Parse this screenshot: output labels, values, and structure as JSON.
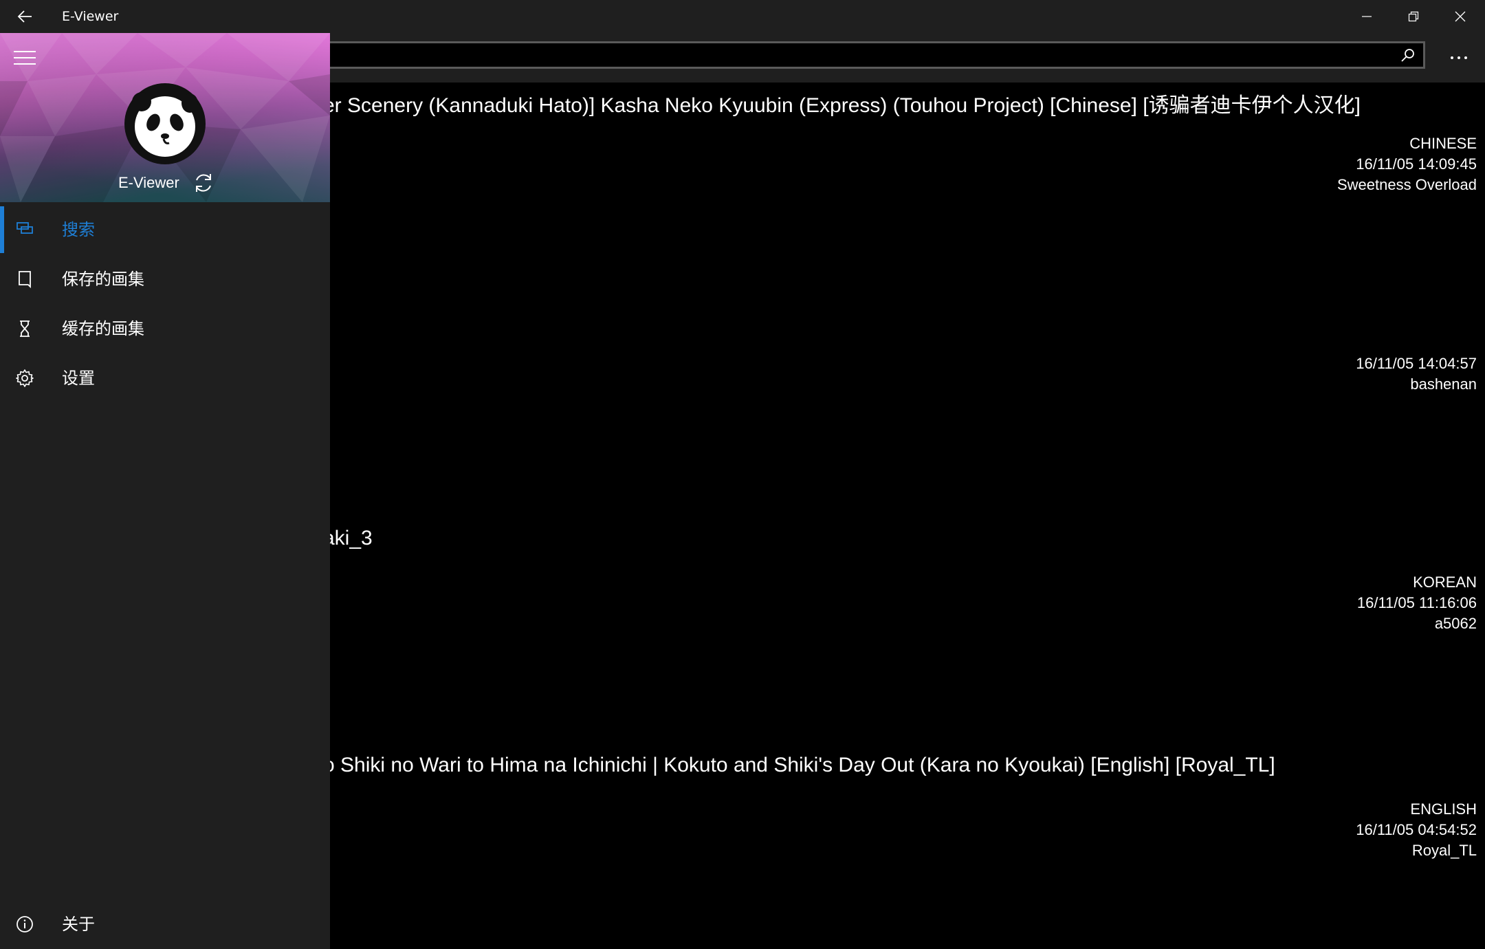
{
  "window": {
    "title": "E-Viewer",
    "controls": {
      "minimize": "minimize-icon",
      "maximize": "restore-icon",
      "close": "close-icon"
    }
  },
  "search": {
    "value": "",
    "placeholder": ""
  },
  "results": [
    {
      "title": "er Scenery (Kannaduki Hato)] Kasha Neko Kyuubin (Express) (Touhou Project) [Chinese] [诱骗者迪卡伊个人汉化]",
      "language": "CHINESE",
      "date": "16/11/05 14:09:45",
      "uploader": "Sweetness Overload"
    },
    {
      "title": "",
      "language": "",
      "date": "16/11/05 14:04:57",
      "uploader": "bashenan"
    },
    {
      "title": "aki_3",
      "language": "KOREAN",
      "date": "16/11/05 11:16:06",
      "uploader": "a5062"
    },
    {
      "title": "o Shiki no Wari to Hima na Ichinichi | Kokuto and Shiki's Day Out (Kara no Kyoukai) [English] [Royal_TL]",
      "language": "ENGLISH",
      "date": "16/11/05 04:54:52",
      "uploader": "Royal_TL"
    }
  ],
  "pane": {
    "app_name": "E-Viewer",
    "items": [
      {
        "label": "搜索",
        "icon": "search-list-icon",
        "selected": true
      },
      {
        "label": "保存的画集",
        "icon": "bookmark-icon",
        "selected": false
      },
      {
        "label": "缓存的画集",
        "icon": "hourglass-icon",
        "selected": false
      },
      {
        "label": "设置",
        "icon": "gear-icon",
        "selected": false
      }
    ],
    "footer": {
      "label": "关于",
      "icon": "info-icon"
    }
  },
  "colors": {
    "accent": "#1e7fd6",
    "chrome": "#1f1f1f",
    "content_bg": "#000000"
  }
}
